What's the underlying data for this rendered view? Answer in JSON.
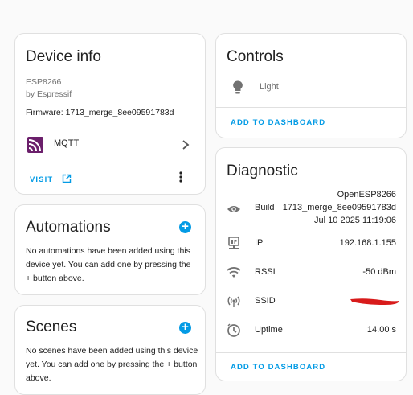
{
  "device_info": {
    "title": "Device info",
    "model": "ESP8266",
    "manufacturer": "by Espressif",
    "firmware": "Firmware: 1713_merge_8ee09591783d",
    "integration": "MQTT",
    "visit_label": "VISIT",
    "icons": {
      "mqtt": "mqtt-icon",
      "chevron": "chevron-right-icon",
      "external": "open-in-new-icon",
      "menu": "dots-vertical-icon"
    },
    "mqtt_color": "#6b1f6b"
  },
  "automations": {
    "title": "Automations",
    "text": "No automations have been added using this device yet. You can add one by pressing the + button above."
  },
  "scenes": {
    "title": "Scenes",
    "text": "No scenes have been added using this device yet. You can add one by pressing the + button above."
  },
  "controls": {
    "title": "Controls",
    "light_label": "Light",
    "add_label": "ADD TO DASHBOARD"
  },
  "diagnostic": {
    "title": "Diagnostic",
    "build_label": "Build",
    "build_value_1": "OpenESP8266",
    "build_value_2": "1713_merge_8ee09591783d",
    "build_value_3": "Jul 10 2025 11:19:06",
    "ip_label": "IP",
    "ip_value": "192.168.1.155",
    "rssi_label": "RSSI",
    "rssi_value": "-50 dBm",
    "ssid_label": "SSID",
    "uptime_label": "Uptime",
    "uptime_value": "14.00 s",
    "add_label": "ADD TO DASHBOARD",
    "redaction_color": "#d81b1b"
  },
  "colors": {
    "accent": "#039be5",
    "icon": "#727272"
  }
}
